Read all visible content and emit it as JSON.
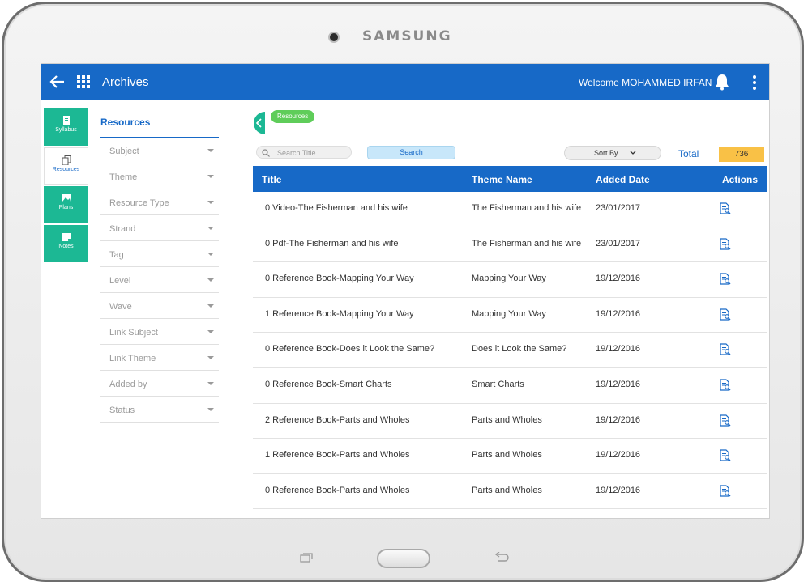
{
  "device": {
    "brand": "SAMSUNG"
  },
  "appbar": {
    "title": "Archives",
    "welcome": "Welcome MOHAMMED IRFAN",
    "accent": "#1769c7"
  },
  "rail": {
    "items": [
      {
        "label": "Syllabus",
        "icon": "book-icon"
      },
      {
        "label": "Resources",
        "icon": "copy-icon"
      },
      {
        "label": "Plans",
        "icon": "image-icon"
      },
      {
        "label": "Notes",
        "icon": "note-icon"
      }
    ]
  },
  "filters": {
    "heading": "Resources",
    "items": [
      "Subject",
      "Theme",
      "Resource Type",
      "Strand",
      "Tag",
      "Level",
      "Wave",
      "Link Subject",
      "Link Theme",
      "Added by",
      "Status"
    ]
  },
  "breadcrumb": {
    "label": "Resources"
  },
  "toolbar": {
    "search_placeholder": "Search Title",
    "search_button": "Search",
    "sort_label": "Sort By",
    "total_label": "Total",
    "total_value": "736"
  },
  "table": {
    "columns": [
      "Title",
      "Theme Name",
      "Added Date",
      "Actions"
    ],
    "rows": [
      {
        "title": "0 Video-The Fisherman and his wife",
        "theme": "The Fisherman and his wife",
        "date": "23/01/2017"
      },
      {
        "title": "0 Pdf-The Fisherman and his wife",
        "theme": "The Fisherman and his wife",
        "date": "23/01/2017"
      },
      {
        "title": "0 Reference Book-Mapping Your Way",
        "theme": "Mapping Your Way",
        "date": "19/12/2016"
      },
      {
        "title": "1 Reference Book-Mapping Your Way",
        "theme": "Mapping Your Way",
        "date": "19/12/2016"
      },
      {
        "title": "0 Reference Book-Does it Look the Same?",
        "theme": "Does it Look the Same?",
        "date": "19/12/2016"
      },
      {
        "title": "0 Reference Book-Smart Charts",
        "theme": "Smart Charts",
        "date": "19/12/2016"
      },
      {
        "title": "2 Reference Book-Parts and Wholes",
        "theme": "Parts and Wholes",
        "date": "19/12/2016"
      },
      {
        "title": "1 Reference Book-Parts and Wholes",
        "theme": "Parts and Wholes",
        "date": "19/12/2016"
      },
      {
        "title": "0 Reference Book-Parts and Wholes",
        "theme": "Parts and Wholes",
        "date": "19/12/2016"
      }
    ]
  }
}
